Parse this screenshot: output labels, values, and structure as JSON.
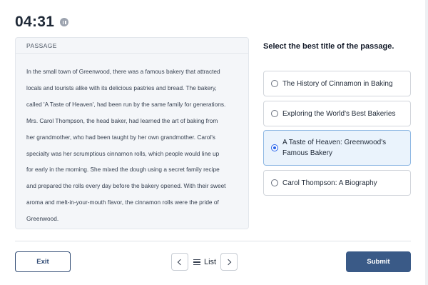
{
  "timer": {
    "value": "04:31"
  },
  "passage": {
    "header": "PASSAGE",
    "lines": [
      "In the small town of Greenwood, there was a famous bakery that attracted",
      "locals and tourists alike with its delicious pastries and bread. The bakery,",
      "called 'A Taste of Heaven', had been run by the same family for generations.",
      "Mrs. Carol Thompson, the head baker, had learned the art of baking from",
      "her grandmother, who had been taught by her own grandmother. Carol's",
      "specialty was her scrumptious cinnamon rolls, which people would line up",
      "for early in the morning. She mixed the dough using a secret family recipe",
      "and prepared the rolls every day before the bakery opened. With their sweet",
      "aroma and melt-in-your-mouth flavor, the cinnamon rolls were the pride of",
      "Greenwood."
    ]
  },
  "question": {
    "text": "Select the best title of the passage."
  },
  "options": [
    {
      "label": "The History of Cinnamon in Baking",
      "selected": false
    },
    {
      "label": "Exploring the World's Best Bakeries",
      "selected": false
    },
    {
      "label": "A Taste of Heaven: Greenwood's Famous Bakery",
      "selected": true
    },
    {
      "label": "Carol Thompson: A Biography",
      "selected": false
    }
  ],
  "footer": {
    "exit_label": "Exit",
    "list_label": "List",
    "submit_label": "Submit"
  },
  "icons": {
    "pause": "pause-icon",
    "prev": "chevron-left-icon",
    "next": "chevron-right-icon",
    "list": "list-icon"
  },
  "colors": {
    "primary": "#3a5a87",
    "selected_bg": "#eaf3fc",
    "radio_selected": "#2563eb"
  }
}
